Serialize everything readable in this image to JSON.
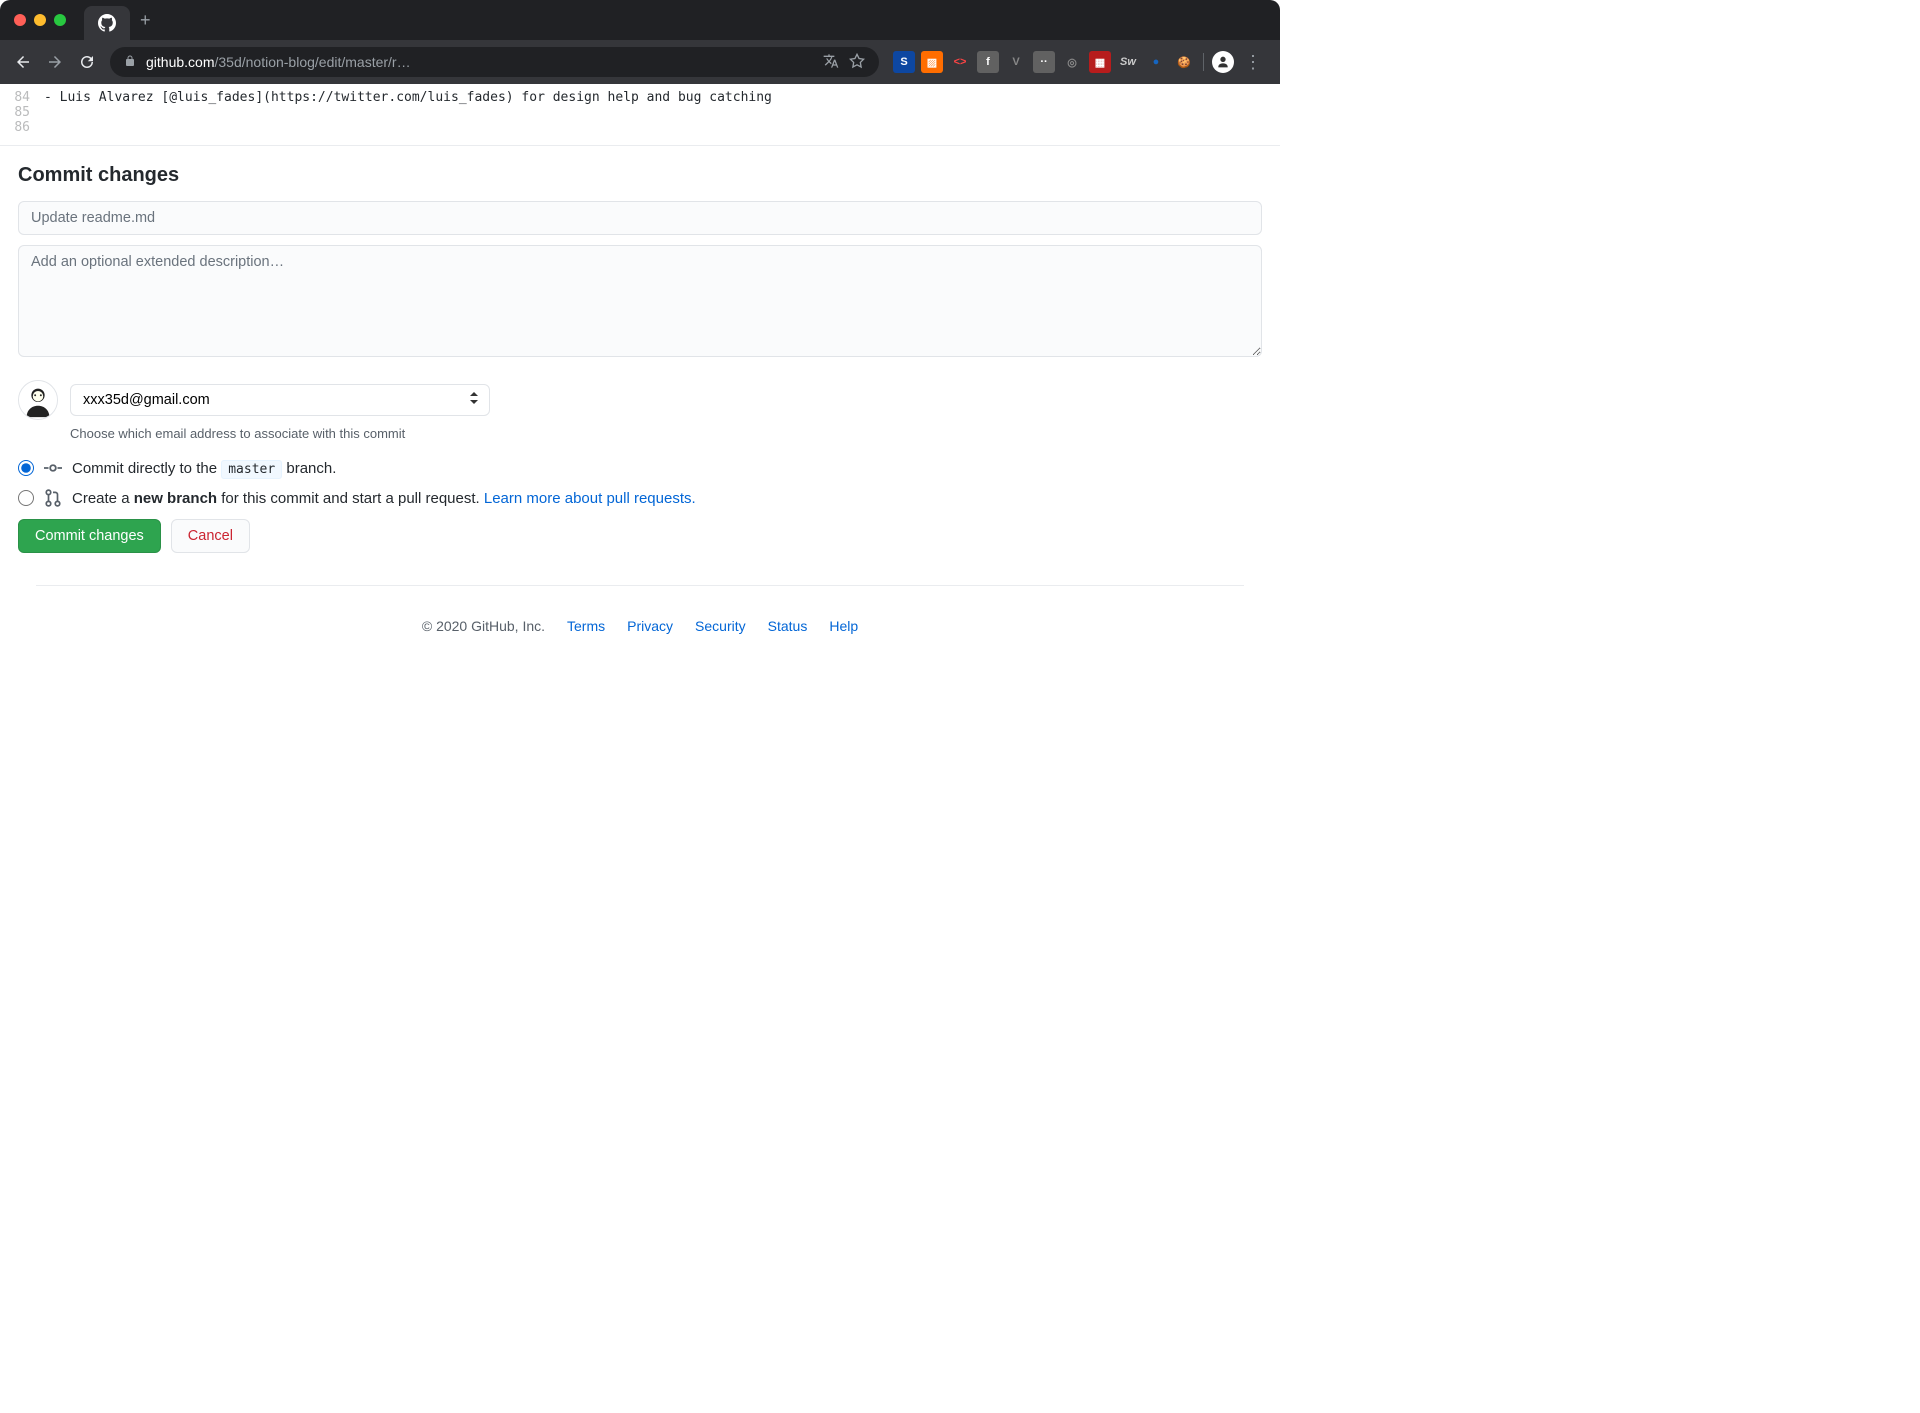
{
  "browser": {
    "url_domain": "github.com",
    "url_path": "/35d/notion-blog/edit/master/r…"
  },
  "ext_icons": [
    "S",
    "📈",
    "<>",
    "f",
    "V",
    "😐",
    "◎",
    "🎮",
    "Sw",
    "●",
    "🍪"
  ],
  "code": {
    "lines": [
      {
        "n": "84",
        "text": "- Luis Alvarez [@luis_fades](https://twitter.com/luis_fades) for design help and bug catching"
      },
      {
        "n": "85",
        "text": ""
      },
      {
        "n": "86",
        "text": ""
      }
    ]
  },
  "commit": {
    "heading": "Commit changes",
    "summary_placeholder": "Update readme.md",
    "description_placeholder": "Add an optional extended description…",
    "email": "xxx35d@gmail.com",
    "email_help": "Choose which email address to associate with this commit",
    "option_direct_pre": "Commit directly to the",
    "option_direct_branch": "master",
    "option_direct_post": "branch.",
    "option_new_pre": "Create a",
    "option_new_bold": "new branch",
    "option_new_post": "for this commit and start a pull request.",
    "learn_more": "Learn more about pull requests.",
    "commit_btn": "Commit changes",
    "cancel_btn": "Cancel"
  },
  "footer": {
    "copyright": "© 2020 GitHub, Inc.",
    "links": [
      "Terms",
      "Privacy",
      "Security",
      "Status",
      "Help"
    ]
  }
}
